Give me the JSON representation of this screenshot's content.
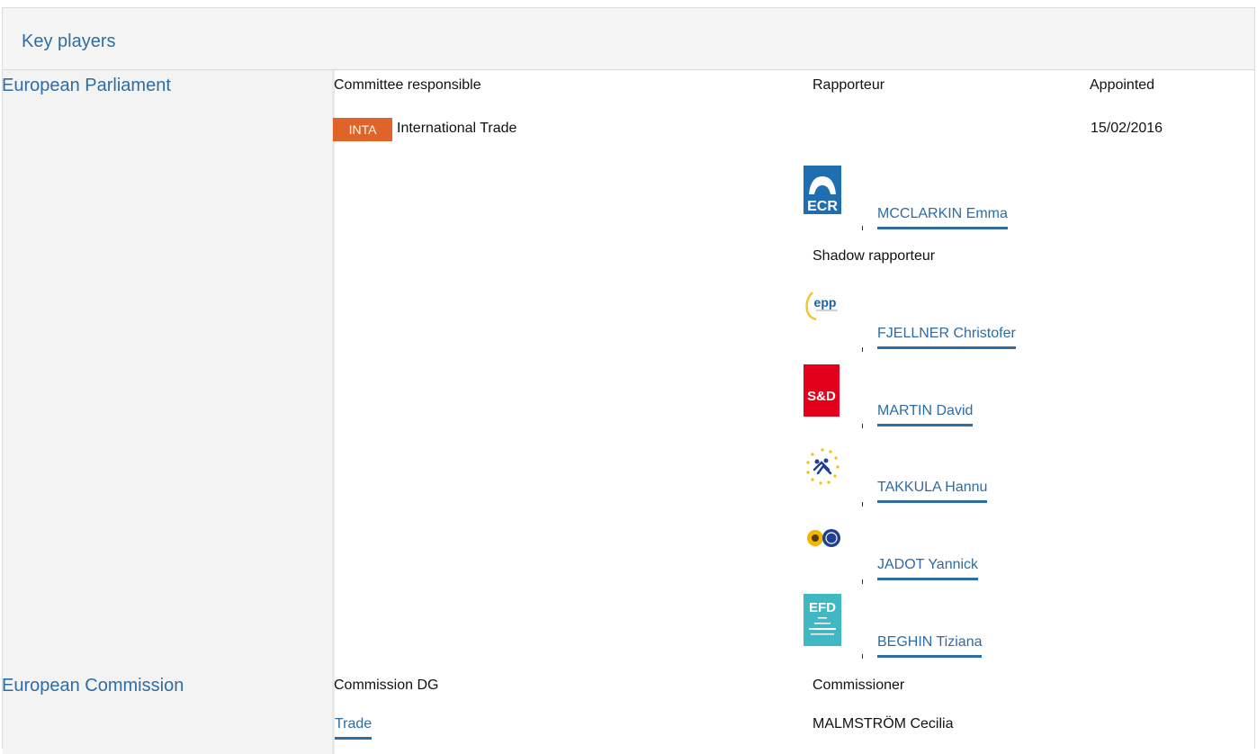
{
  "header": {
    "title": "Key players"
  },
  "parliament": {
    "label": "European Parliament",
    "col_committee": "Committee responsible",
    "col_rapporteur": "Rapporteur",
    "col_appointed": "Appointed",
    "committee_code": "INTA",
    "committee_name": "International Trade",
    "appointed_date": "15/02/2016",
    "rapporteur": {
      "group_logo": "ECR",
      "name": "MCCLARKIN Emma"
    },
    "shadow_label": "Shadow rapporteur",
    "shadows": [
      {
        "group_logo": "epp",
        "name": "FJELLNER Christofer"
      },
      {
        "group_logo": "S&D",
        "name": "MARTIN David"
      },
      {
        "group_logo": "alde-stars-icon",
        "name": "TAKKULA Hannu"
      },
      {
        "group_logo": "greens-efa-icon",
        "name": "JADOT Yannick"
      },
      {
        "group_logo": "EFD",
        "name": "BEGHIN Tiziana"
      }
    ]
  },
  "commission": {
    "label": "European Commission",
    "col_dg": "Commission DG",
    "col_commissioner": "Commissioner",
    "dg": "Trade",
    "commissioner": "MALMSTRÖM Cecilia"
  },
  "colors": {
    "accent": "#2e6ca4",
    "tag": "#e0632a",
    "ecr": "#1f6fb0",
    "sd": "#e3001b",
    "efd": "#3fb8c4"
  }
}
